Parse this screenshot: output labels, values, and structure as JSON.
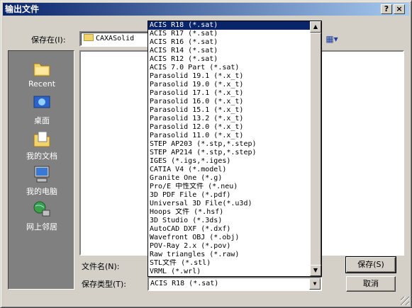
{
  "window": {
    "title": "输出文件",
    "help_label": "?",
    "close_label": "×"
  },
  "look_in": {
    "label": "保存在(I):",
    "value": "CAXASolid",
    "view_icon": "view-menu-icon"
  },
  "places": [
    {
      "label": "Recent",
      "icon": "recent-icon"
    },
    {
      "label": "桌面",
      "icon": "desktop-icon"
    },
    {
      "label": "我的文档",
      "icon": "my-documents-icon"
    },
    {
      "label": "我的电脑",
      "icon": "my-computer-icon"
    },
    {
      "label": "网上邻居",
      "icon": "network-icon"
    }
  ],
  "filename": {
    "label": "文件名(N):",
    "value": ""
  },
  "filetype": {
    "label": "保存类型(T):",
    "value": "ACIS R18 (*.sat)"
  },
  "buttons": {
    "save": "保存(S)",
    "cancel": "取消"
  },
  "filetype_options": [
    "ACIS R18 (*.sat)",
    "ACIS R17 (*.sat)",
    "ACIS R16 (*.sat)",
    "ACIS R14 (*.sat)",
    "ACIS R12 (*.sat)",
    "ACIS 7.0 Part (*.sat)",
    "Parasolid 19.1 (*.x_t)",
    "Parasolid 19.0 (*.x_t)",
    "Parasolid 17.1 (*.x_t)",
    "Parasolid 16.0 (*.x_t)",
    "Parasolid 15.1 (*.x_t)",
    "Parasolid 13.2 (*.x_t)",
    "Parasolid 12.0 (*.x_t)",
    "Parasolid 11.0 (*.x_t)",
    "STEP AP203 (*.stp,*.step)",
    "STEP AP214 (*.stp,*.step)",
    "IGES (*.igs,*.iges)",
    "CATIA V4 (*.model)",
    "Granite One (*.g)",
    "Pro/E 中性文件 (*.neu)",
    "3D PDF File (*.pdf)",
    "Universal 3D File(*.u3d)",
    "Hoops 文件 (*.hsf)",
    "3D Studio (*.3ds)",
    "AutoCAD DXF (*.dxf)",
    "Wavefront OBJ (*.obj)",
    "POV-Ray 2.x (*.pov)",
    "Raw triangles (*.raw)",
    "STL文件 (*.stl)",
    "VRML (*.wrl)"
  ],
  "selected_index": 0
}
